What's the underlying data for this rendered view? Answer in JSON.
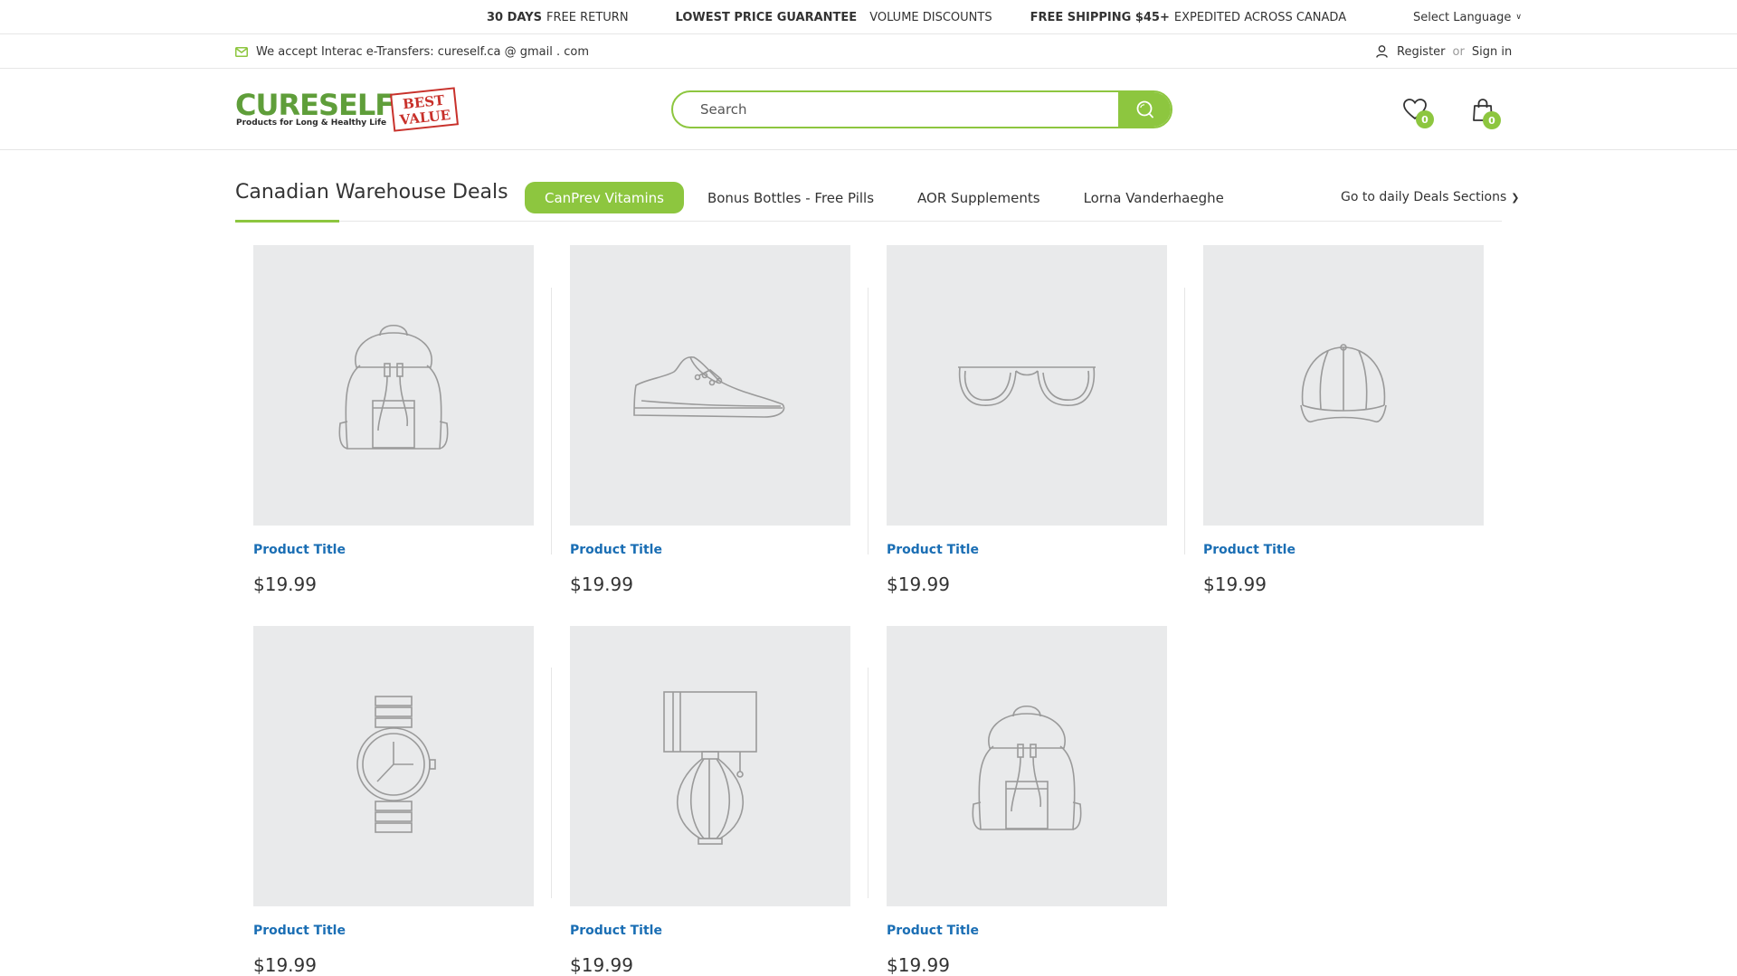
{
  "topbar": {
    "promos": [
      {
        "bold": "30 DAYS",
        "text": "FREE RETURN"
      },
      {
        "bold": "LOWEST PRICE GUARANTEE",
        "text": "VOLUME DISCOUNTS"
      },
      {
        "bold": "FREE SHIPPING $45+",
        "text": "EXPEDITED ACROSS CANADA"
      }
    ],
    "language_label": "Select Language"
  },
  "subbar": {
    "interac_text": "We accept Interac e-Transfers: cureself.ca @ gmail . com",
    "register_label": "Register",
    "or_label": "or",
    "signin_label": "Sign in"
  },
  "header": {
    "logo_word": "CURESELF",
    "logo_tagline": "Products for Long & Healthy Life",
    "logo_badge_line1": "BEST",
    "logo_badge_line2": "VALUE",
    "search_placeholder": "Search",
    "wishlist_count": "0",
    "cart_count": "0",
    "icons": {
      "search": "search-icon",
      "wishlist": "heart-icon",
      "cart": "shopping-bag-icon",
      "mail": "mail-icon",
      "user": "user-icon"
    }
  },
  "deals": {
    "title": "Canadian Warehouse Deals",
    "tabs": [
      "CanPrev Vitamins",
      "Bonus Bottles - Free Pills",
      "AOR Supplements",
      "Lorna Vanderhaeghe"
    ],
    "active_tab": "CanPrev Vitamins",
    "link_label": "Go to daily Deals Sections"
  },
  "products": [
    {
      "title": "Product Title",
      "price": "$19.99",
      "icon": "backpack-icon"
    },
    {
      "title": "Product Title",
      "price": "$19.99",
      "icon": "sneaker-icon"
    },
    {
      "title": "Product Title",
      "price": "$19.99",
      "icon": "sunglasses-icon"
    },
    {
      "title": "Product Title",
      "price": "$19.99",
      "icon": "cap-icon"
    },
    {
      "title": "Product Title",
      "price": "$19.99",
      "icon": "watch-icon"
    },
    {
      "title": "Product Title",
      "price": "$19.99",
      "icon": "lamp-icon"
    },
    {
      "title": "Product Title",
      "price": "$19.99",
      "icon": "backpack-icon"
    }
  ],
  "colors": {
    "accent": "#8dc63f",
    "link": "#1a6eb4",
    "logo_green": "#5f9e3a",
    "logo_red": "#c8312b",
    "placeholder_bg": "#e9eaeb"
  }
}
